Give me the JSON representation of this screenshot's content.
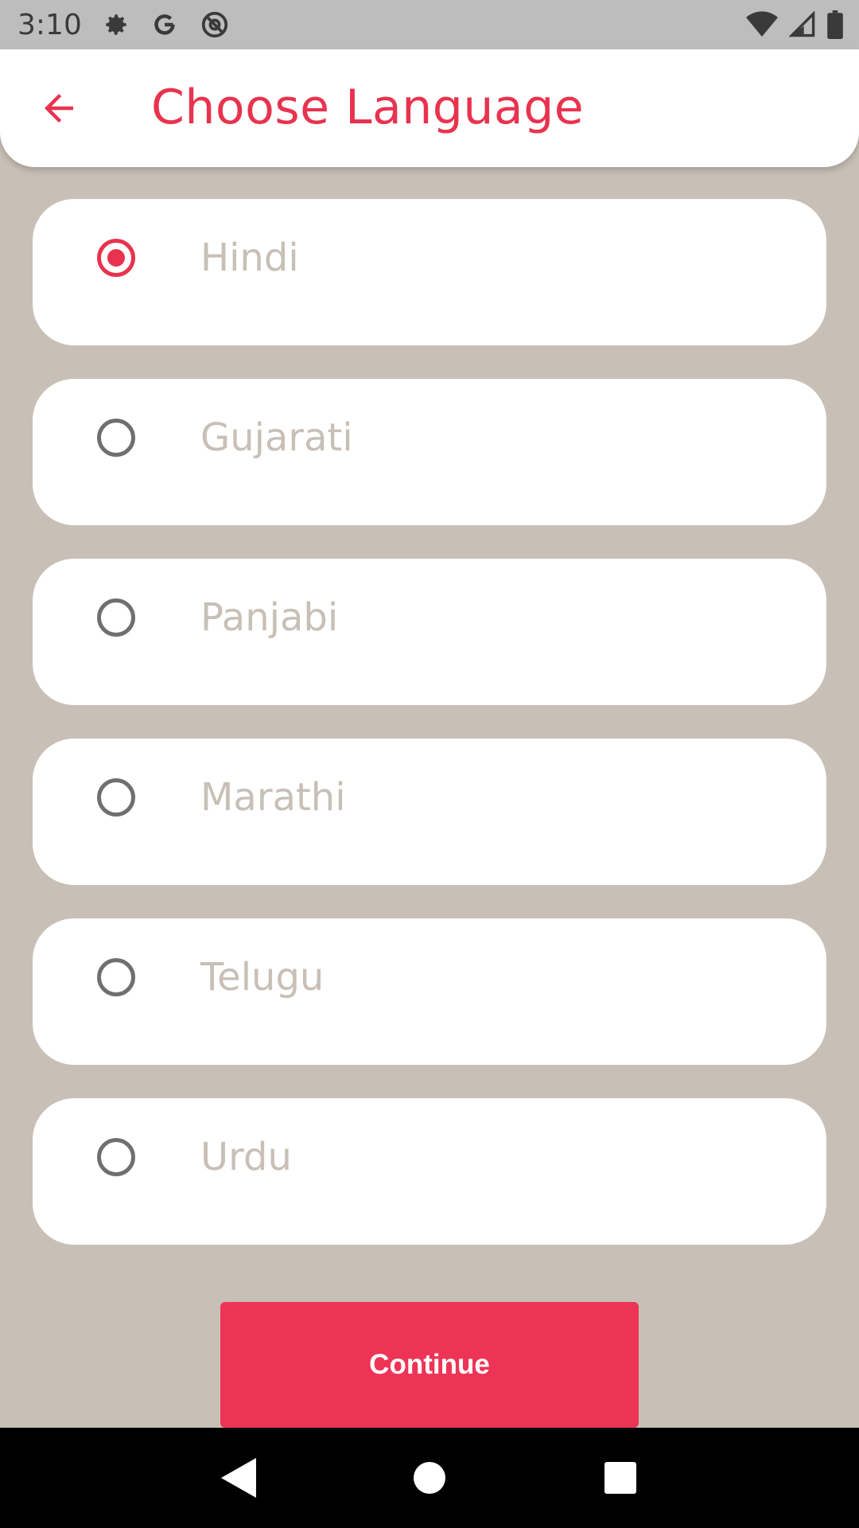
{
  "status_bar": {
    "time": "3:10",
    "icons_left": [
      "gear-icon",
      "google-icon",
      "at-sign-icon"
    ],
    "icons_right": [
      "wifi-icon",
      "signal-icon",
      "battery-icon"
    ]
  },
  "app_bar": {
    "title": "Choose Language",
    "back_icon": "arrow-left-icon"
  },
  "languages": [
    {
      "label": "Hindi",
      "selected": true
    },
    {
      "label": "Gujarati",
      "selected": false
    },
    {
      "label": "Panjabi",
      "selected": false
    },
    {
      "label": "Marathi",
      "selected": false
    },
    {
      "label": "Telugu",
      "selected": false
    },
    {
      "label": "Urdu",
      "selected": false
    }
  ],
  "continue_button": {
    "label": "Continue"
  },
  "colors": {
    "accent": "#e8334f",
    "button": "#ee3456",
    "background": "#c8bfb6",
    "card": "#ffffff"
  },
  "nav_bar": {
    "buttons": [
      "back-triangle-icon",
      "home-circle-icon",
      "recents-square-icon"
    ]
  }
}
